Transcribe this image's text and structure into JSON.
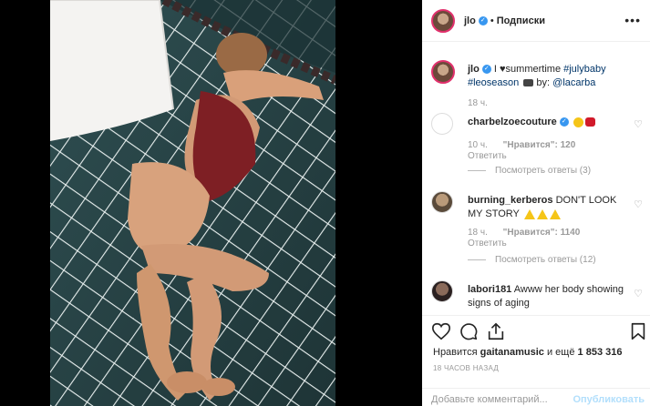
{
  "header": {
    "username": "jlo",
    "separator": "•",
    "follow_label": "Подписки",
    "more_icon": "more-horizontal-icon"
  },
  "caption": {
    "username": "jlo",
    "text_prefix": "I ♥summertime",
    "hashtag1": "#julybaby",
    "hashtag2": "#leoseason",
    "by_label": "by:",
    "mention": "@lacarba",
    "time": "18 ч."
  },
  "comments": [
    {
      "username": "charbelzoecouture",
      "text": "",
      "time": "10 ч.",
      "likes": "\"Нравится\": 120",
      "reply": "Ответить",
      "view_replies": "Посмотреть ответы (3)"
    },
    {
      "username": "burning_kerberos",
      "text": "DON'T LOOK MY STORY",
      "time": "18 ч.",
      "likes": "\"Нравится\": 1140",
      "reply": "Ответить",
      "view_replies": "Посмотреть ответы (12)"
    },
    {
      "username": "labori181",
      "text": "Awww her body showing signs of aging"
    }
  ],
  "actions": {
    "likes_prefix": "Нравится",
    "liker": "gaitanamusic",
    "likes_middle": "и ещё",
    "likes_count": "1 853 316",
    "time_ago": "18 ЧАСОВ НАЗАД"
  },
  "add_comment": {
    "placeholder": "Добавьте комментарий...",
    "publish_label": "Опубликовать"
  },
  "colors": {
    "verified": "#3897f0",
    "link": "#003569",
    "publish_disabled": "#b2dffc"
  }
}
